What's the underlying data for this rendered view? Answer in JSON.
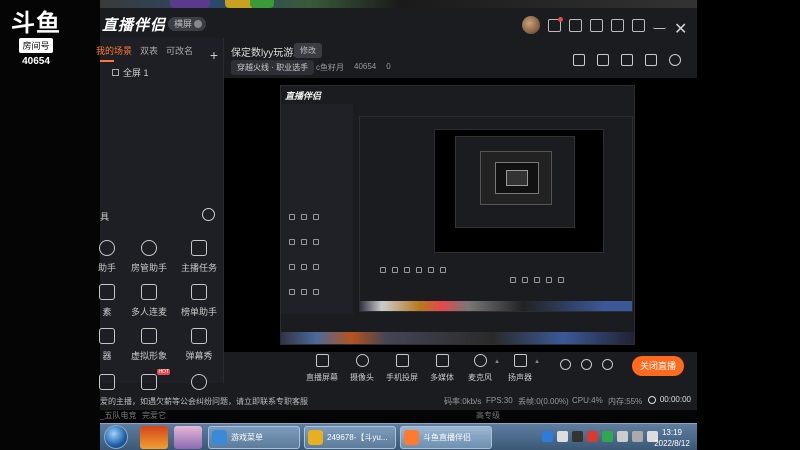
{
  "watermark": {
    "logo": "斗鱼",
    "badge": "房间号",
    "room": "40654"
  },
  "app": {
    "brand": "直播伴侣",
    "mode_label": "横屏",
    "left_tabs": [
      "我的场景",
      "双表",
      "可改名"
    ],
    "add_label": "+",
    "scene_label": "全屏 1",
    "tools_header": "具",
    "tools": [
      {
        "label": "助手",
        "icon": "assistant-icon"
      },
      {
        "label": "房管助手",
        "icon": "user-icon"
      },
      {
        "label": "主播任务",
        "icon": "task-icon"
      },
      {
        "label": "素",
        "icon": "material-icon"
      },
      {
        "label": "多人连麦",
        "icon": "download-icon"
      },
      {
        "label": "榜单助手",
        "icon": "rank-icon"
      },
      {
        "label": "器",
        "icon": "device-icon"
      },
      {
        "label": "虚拟形象",
        "icon": "avatar-icon"
      },
      {
        "label": "弹幕秀",
        "icon": "tv-icon"
      },
      {
        "label": "",
        "icon": "screen-icon"
      },
      {
        "label": "",
        "icon": "pk-icon"
      },
      {
        "label": "",
        "icon": "download2-icon"
      }
    ],
    "stream": {
      "title": "保定数lyy玩游戏",
      "edit_label": "修改",
      "category": "穿越火线 · 职业选手",
      "fans_label": "c鱼籽月",
      "viewer_count": "40654",
      "likes": "0"
    },
    "toolbar": [
      {
        "label": "直播屏幕",
        "icon": "monitor-icon"
      },
      {
        "label": "摄像头",
        "icon": "camera-icon"
      },
      {
        "label": "手机投屏",
        "icon": "phone-icon"
      },
      {
        "label": "多媒体",
        "icon": "media-icon"
      },
      {
        "label": "麦克风",
        "icon": "mic-icon"
      },
      {
        "label": "扬声器",
        "icon": "speaker-icon"
      }
    ],
    "go_live_label": "关闭直播",
    "status": {
      "notice": "爱的主播，如遇欠薪等公会纠纷问题，请立即联系专职客服",
      "bitrate": "码率:0kb/s",
      "fps": "FPS:30",
      "drop": "丢帧:0(0.00%)",
      "cpu": "CPU:4%",
      "mem": "内存:55%",
      "time": "00:00:00"
    },
    "below_left": "_五队电竞",
    "below_mid": "完爱它",
    "below_right": "高专级"
  },
  "taskbar": {
    "tasks": [
      {
        "label": "游戏菜单"
      },
      {
        "label": "249678-【斗yu..."
      },
      {
        "label": "斗鱼直播伴侣"
      }
    ],
    "clock_time": "13:19",
    "clock_date": "2022/8/12"
  },
  "colors": {
    "accent": "#ff6a1f",
    "bg": "#1b1c20"
  }
}
